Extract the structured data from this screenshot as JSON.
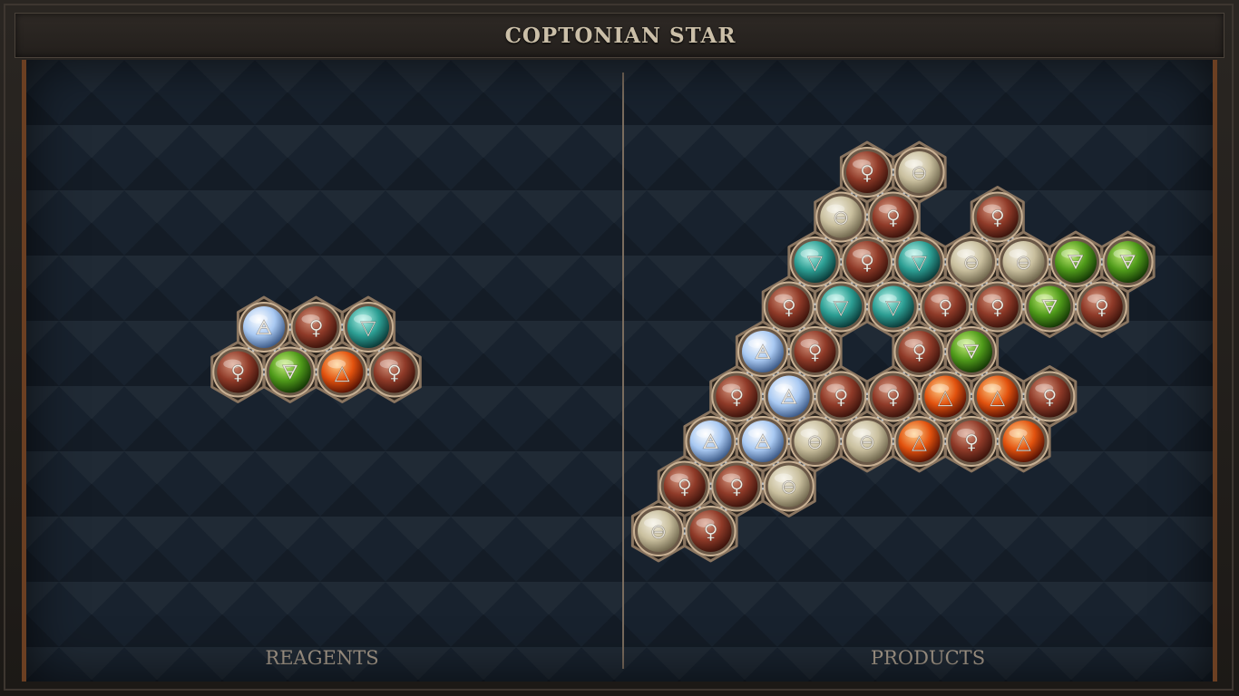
{
  "header": {
    "title": "COPTONIAN STAR"
  },
  "reagents": {
    "label": "REAGENTS",
    "atoms": [
      {
        "element": "air",
        "row": 0,
        "col": 0
      },
      {
        "element": "copper",
        "row": 0,
        "col": 1
      },
      {
        "element": "water",
        "row": 0,
        "col": 2
      },
      {
        "element": "copper",
        "row": 1,
        "col": 0
      },
      {
        "element": "earth",
        "row": 1,
        "col": 1
      },
      {
        "element": "fire",
        "row": 1,
        "col": 2
      },
      {
        "element": "copper",
        "row": 1,
        "col": 3
      }
    ]
  },
  "products": {
    "label": "PRODUCTS",
    "atoms": [
      {
        "element": "copper",
        "row": 0,
        "col": 0
      },
      {
        "element": "salt",
        "row": 0,
        "col": 1
      },
      {
        "element": "salt",
        "row": 1,
        "col": 0
      },
      {
        "element": "copper",
        "row": 1,
        "col": 1
      },
      {
        "element": "copper",
        "row": 1,
        "col": 3
      },
      {
        "element": "water",
        "row": 2,
        "col": 0
      },
      {
        "element": "copper",
        "row": 2,
        "col": 1
      },
      {
        "element": "water",
        "row": 2,
        "col": 2
      },
      {
        "element": "salt",
        "row": 2,
        "col": 3
      },
      {
        "element": "salt",
        "row": 2,
        "col": 4
      },
      {
        "element": "earth",
        "row": 2,
        "col": 5
      },
      {
        "element": "earth",
        "row": 2,
        "col": 6
      },
      {
        "element": "copper",
        "row": 3,
        "col": 0
      },
      {
        "element": "water",
        "row": 3,
        "col": 1
      },
      {
        "element": "water",
        "row": 3,
        "col": 2
      },
      {
        "element": "copper",
        "row": 3,
        "col": 3
      },
      {
        "element": "copper",
        "row": 3,
        "col": 4
      },
      {
        "element": "earth",
        "row": 3,
        "col": 5
      },
      {
        "element": "copper",
        "row": 3,
        "col": 6
      },
      {
        "element": "air",
        "row": 4,
        "col": 0
      },
      {
        "element": "copper",
        "row": 4,
        "col": 1
      },
      {
        "element": "copper",
        "row": 4,
        "col": 3
      },
      {
        "element": "earth",
        "row": 4,
        "col": 4
      },
      {
        "element": "copper",
        "row": 5,
        "col": 0
      },
      {
        "element": "air",
        "row": 5,
        "col": 1
      },
      {
        "element": "copper",
        "row": 5,
        "col": 2
      },
      {
        "element": "copper",
        "row": 5,
        "col": 3
      },
      {
        "element": "fire",
        "row": 5,
        "col": 4
      },
      {
        "element": "fire",
        "row": 5,
        "col": 5
      },
      {
        "element": "copper",
        "row": 5,
        "col": 6
      },
      {
        "element": "air",
        "row": 6,
        "col": 0
      },
      {
        "element": "air",
        "row": 6,
        "col": 1
      },
      {
        "element": "salt",
        "row": 6,
        "col": 2
      },
      {
        "element": "salt",
        "row": 6,
        "col": 3
      },
      {
        "element": "fire",
        "row": 6,
        "col": 4
      },
      {
        "element": "copper",
        "row": 6,
        "col": 5
      },
      {
        "element": "fire",
        "row": 6,
        "col": 6
      },
      {
        "element": "copper",
        "row": 7,
        "col": 0
      },
      {
        "element": "copper",
        "row": 7,
        "col": 1
      },
      {
        "element": "salt",
        "row": 7,
        "col": 2
      },
      {
        "element": "salt",
        "row": 8,
        "col": 0
      },
      {
        "element": "copper",
        "row": 8,
        "col": 1
      }
    ]
  },
  "elements": {
    "copper": {
      "symbol": "♀",
      "icon": "copper-icon",
      "colors": [
        "#d89a82",
        "#8f3a28",
        "#3e140c"
      ]
    },
    "salt": {
      "symbol": "⊖",
      "icon": "salt-icon",
      "colors": [
        "#f4f0e2",
        "#c9bf9e",
        "#736a50"
      ]
    },
    "water": {
      "symbol": "▽",
      "icon": "water-icon",
      "colors": [
        "#b7f5ea",
        "#2c9e93",
        "#0b3c3a"
      ]
    },
    "earth": {
      "symbol": "🜃",
      "icon": "earth-icon",
      "colors": [
        "#c8f07a",
        "#4f9a1a",
        "#163a06"
      ]
    },
    "fire": {
      "symbol": "△",
      "icon": "fire-icon",
      "colors": [
        "#ffd08a",
        "#e2520e",
        "#5a1304"
      ]
    },
    "air": {
      "symbol": "🜁",
      "icon": "air-icon",
      "colors": [
        "#ffffff",
        "#a9c9f2",
        "#3e5c8a"
      ]
    }
  }
}
